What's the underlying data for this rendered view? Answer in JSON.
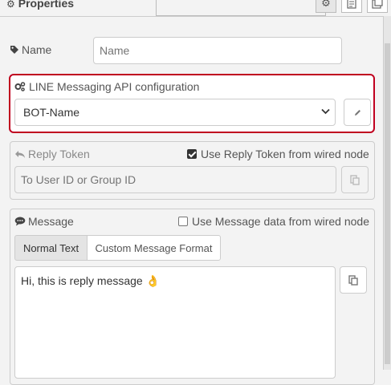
{
  "header": {
    "title": "Properties",
    "title_icon": "gear-icon",
    "buttons": [
      "gear-icon",
      "document-icon",
      "export-icon"
    ]
  },
  "name_row": {
    "label": "Name",
    "icon": "tag-icon",
    "placeholder": "Name"
  },
  "config": {
    "label": "LINE Messaging API configuration",
    "icon": "cogs-icon",
    "selected": "BOT-Name",
    "edit_icon": "pencil-icon",
    "highlight_color": "#c0001f"
  },
  "reply": {
    "label": "Reply Token",
    "icon": "reply-icon",
    "checkbox_label": "Use Reply Token from wired node",
    "checked": true,
    "placeholder": "To User ID or Group ID",
    "copy_icon": "copy-icon"
  },
  "message": {
    "label": "Message",
    "icon": "comment-icon",
    "checkbox_label": "Use Message data from wired node",
    "checked": false,
    "tabs": [
      "Normal Text",
      "Custom Message Format"
    ],
    "active_tab": "Normal Text",
    "text": "Hi, this is reply message 👌",
    "copy_icon": "copy-icon"
  }
}
